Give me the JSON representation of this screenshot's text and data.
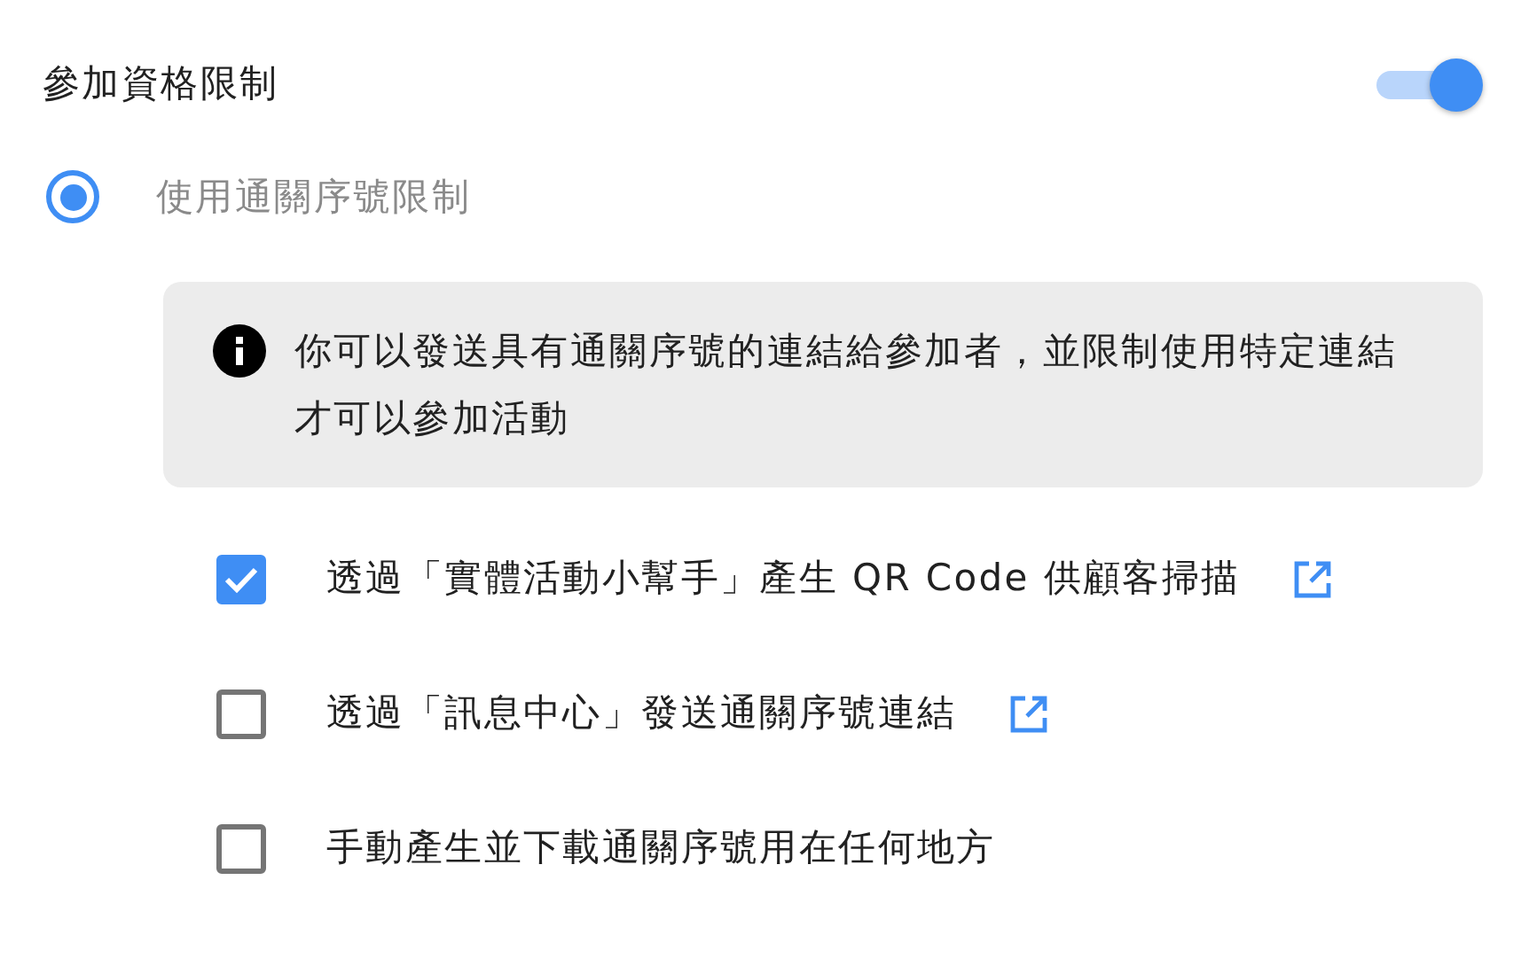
{
  "header": {
    "title": "參加資格限制",
    "toggle": {
      "on": true
    }
  },
  "option": {
    "label": "使用通關序號限制",
    "selected": true
  },
  "info": {
    "text": "你可以發送具有通關序號的連結給參加者，並限制使用特定連結才可以參加活動"
  },
  "items": [
    {
      "label": "透過「實體活動小幫手」產生 QR Code 供顧客掃描",
      "checked": true,
      "external_link": true
    },
    {
      "label": "透過「訊息中心」發送通關序號連結",
      "checked": false,
      "external_link": true
    },
    {
      "label": "手動產生並下載通關序號用在任何地方",
      "checked": false,
      "external_link": false
    }
  ]
}
